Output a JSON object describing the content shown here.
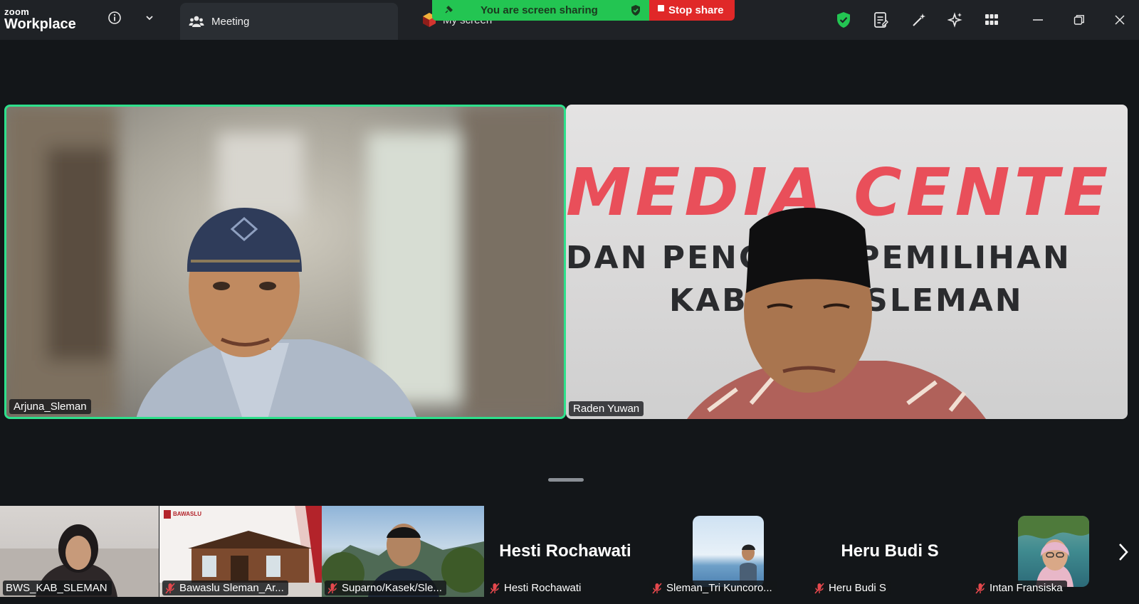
{
  "app": {
    "logo_small": "zoom",
    "logo_big": "Workplace"
  },
  "tabs": {
    "meeting": "Meeting",
    "my_screen": "My screen"
  },
  "sharing": {
    "banner": "You are screen sharing",
    "stop": "Stop share",
    "banner_color": "#23c552",
    "stop_color": "#e02828"
  },
  "main_videos": [
    {
      "name": "Arjuna_Sleman",
      "active_speaker": true
    },
    {
      "name": "Raden Yuwan",
      "backdrop": {
        "line1": "MEDIA CENTE",
        "line2": "DAN PENG    S PEMILIHAN",
        "line3": "KAB    EN SLEMAN"
      }
    }
  ],
  "thumbnails": [
    {
      "name": "BWS_KAB_SLEMAN",
      "muted": false,
      "type": "video"
    },
    {
      "name": "Bawaslu Sleman_Ar...",
      "muted": true,
      "type": "video",
      "logo_text": "BAWASLU"
    },
    {
      "name": "Suparno/Kasek/Sle...",
      "muted": true,
      "type": "video"
    },
    {
      "name": "Hesti Rochawati",
      "muted": true,
      "type": "name",
      "display": "Hesti Rochawati"
    },
    {
      "name": "Sleman_Tri Kuncoro...",
      "muted": true,
      "type": "avatar"
    },
    {
      "name": "Heru Budi S",
      "muted": true,
      "type": "name",
      "display": "Heru Budi S"
    },
    {
      "name": "Intan Fransiska",
      "muted": true,
      "type": "avatar"
    }
  ],
  "colors": {
    "active_border": "#2ee08c",
    "muted_icon": "#e5484d",
    "shield": "#23c552"
  }
}
